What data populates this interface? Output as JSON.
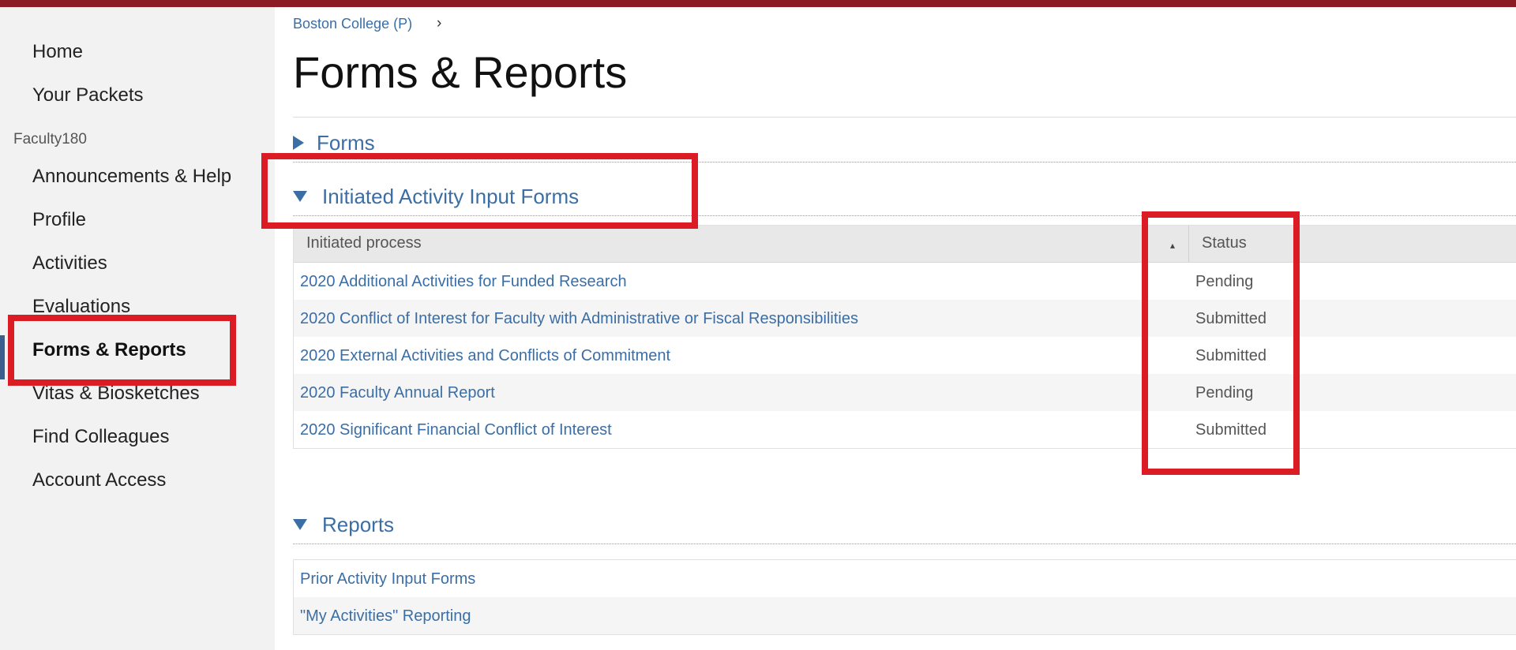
{
  "sidebar": {
    "items_top": [
      "Home",
      "Your Packets"
    ],
    "section_label": "Faculty180",
    "items": [
      "Announcements & Help",
      "Profile",
      "Activities",
      "Evaluations",
      "Forms & Reports",
      "Vitas & Biosketches",
      "Find Colleagues",
      "Account Access"
    ],
    "active_item": "Forms & Reports"
  },
  "header": {
    "breadcrumb": "Boston College (P)",
    "breadcrumb_chevron": "chevron-right-icon",
    "title": "Forms & Reports"
  },
  "sections": {
    "forms": {
      "label": "Forms",
      "expanded": false
    },
    "initiated": {
      "label": "Initiated Activity Input Forms",
      "expanded": true
    },
    "reports": {
      "label": "Reports",
      "expanded": true
    }
  },
  "initiated_table": {
    "columns": [
      "Initiated process",
      "Status"
    ],
    "rows": [
      {
        "process": "2020 Additional Activities for Funded Research",
        "status": "Pending"
      },
      {
        "process": "2020 Conflict of Interest for Faculty with Administrative or Fiscal Responsibilities",
        "status": "Submitted"
      },
      {
        "process": "2020 External Activities and Conflicts of Commitment",
        "status": "Submitted"
      },
      {
        "process": "2020 Faculty Annual Report",
        "status": "Pending"
      },
      {
        "process": "2020 Significant Financial Conflict of Interest",
        "status": "Submitted"
      }
    ]
  },
  "reports_list": [
    "Prior Activity Input Forms",
    "\"My Activities\" Reporting"
  ],
  "colors": {
    "topbar": "#8b1c24",
    "link": "#3a6ea5",
    "highlight": "#dc1c24",
    "sidebar_bg": "#f2f2f2"
  }
}
